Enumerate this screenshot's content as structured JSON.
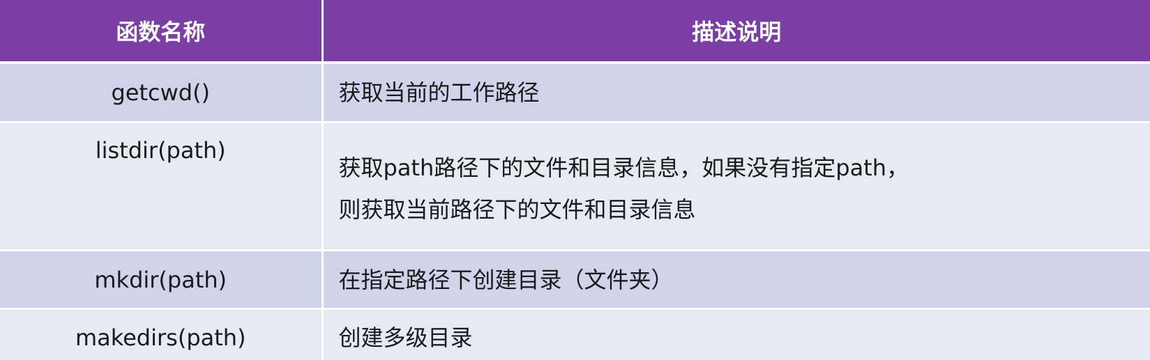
{
  "table": {
    "headers": [
      "函数名称",
      "描述说明"
    ],
    "rows": [
      {
        "name": "getcwd()",
        "description": [
          "获取当前的工作路径"
        ]
      },
      {
        "name": "listdir(path)",
        "description": [
          "获取path路径下的文件和目录信息，如果没有指定path，",
          "则获取当前路径下的文件和目录信息"
        ]
      },
      {
        "name": "mkdir(path)",
        "description": [
          "在指定路径下创建目录（文件夹）"
        ]
      },
      {
        "name": "makedirs(path)",
        "description": [
          "创建多级目录"
        ]
      }
    ]
  },
  "colors": {
    "header_bg": "#7a3ea4",
    "row_odd_bg": "#cfd4ea",
    "row_even_bg": "#e7e9f3"
  }
}
